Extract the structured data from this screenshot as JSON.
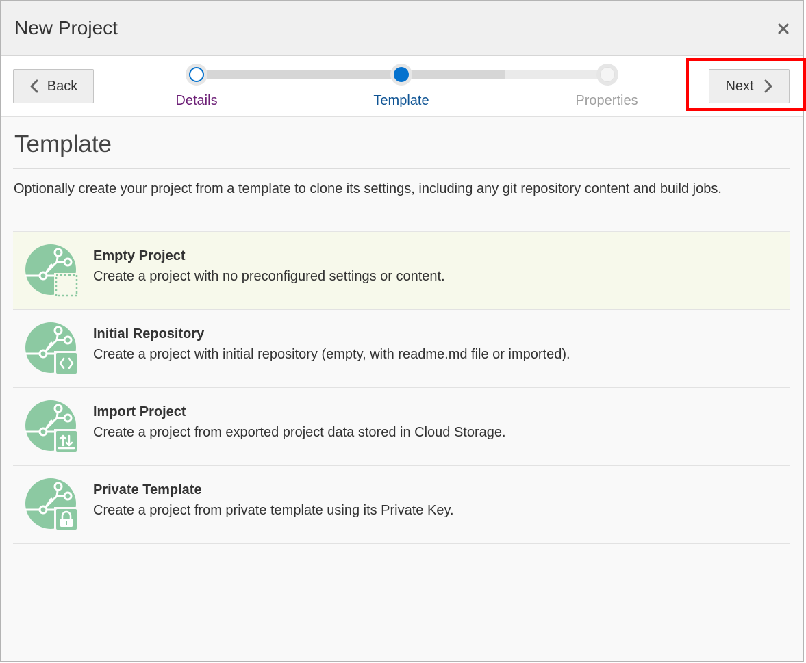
{
  "dialog": {
    "title": "New Project",
    "close_icon": "close-icon"
  },
  "nav": {
    "back_label": "Back",
    "next_label": "Next",
    "steps": [
      {
        "label": "Details",
        "state": "visited"
      },
      {
        "label": "Template",
        "state": "current"
      },
      {
        "label": "Properties",
        "state": "disabled"
      }
    ]
  },
  "main": {
    "section_title": "Template",
    "description": "Optionally create your project from a template to clone its settings, including any git repository content and build jobs.",
    "templates": [
      {
        "name": "Empty Project",
        "description": "Create a project with no preconfigured settings or content.",
        "icon": "empty-project-icon",
        "selected": true
      },
      {
        "name": "Initial Repository",
        "description": "Create a project with initial repository (empty, with readme.md file or imported).",
        "icon": "initial-repository-icon",
        "selected": false
      },
      {
        "name": "Import Project",
        "description": "Create a project from exported project data stored in Cloud Storage.",
        "icon": "import-project-icon",
        "selected": false
      },
      {
        "name": "Private Template",
        "description": "Create a project from private template using its Private Key.",
        "icon": "private-template-icon",
        "selected": false
      }
    ]
  },
  "colors": {
    "accent": "#0572ce",
    "visited_step": "#6d2077",
    "selected_row": "#f7f9eb",
    "icon_green": "#8cc9a2",
    "highlight": "#ff0000"
  }
}
